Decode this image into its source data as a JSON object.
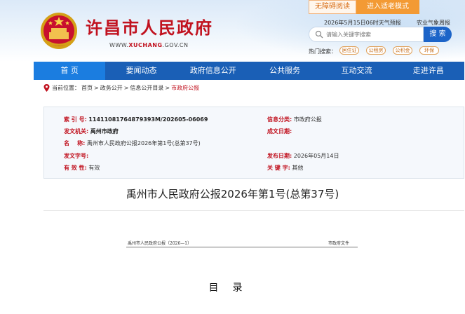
{
  "header": {
    "site_title": "许昌市人民政府",
    "domain_prefix": "WWW.",
    "domain_highlight": "XUCHANG",
    "domain_suffix": ".GOV.CN",
    "barrier_free": "无障碍阅读",
    "elder_mode": "进入适老模式",
    "weather": "2026年5月15日06时天气预报",
    "agri_weather": "农业气象周报",
    "search_placeholder": "请输入关键字搜索",
    "search_button": "搜 索",
    "hot_label": "热门搜索：",
    "hot_tags": [
      "居住证",
      "公租房",
      "公积金",
      "环保"
    ]
  },
  "nav": {
    "items": [
      "首 页",
      "要闻动态",
      "政府信息公开",
      "公共服务",
      "互动交流",
      "走进许昌"
    ]
  },
  "breadcrumb": {
    "label": "当前位置：",
    "items": [
      "首页",
      "政务公开",
      "信息公开目录"
    ],
    "current": "市政府公报",
    "sep": ">"
  },
  "info": {
    "index_label": "索 引 号:",
    "index_value": "11411081764879393M/202605-06069",
    "category_label": "信息分类:",
    "category_value": "市政府公报",
    "issuer_label": "发文机关:",
    "issuer_value": "禹州市政府",
    "date_label": "成文日期:",
    "date_value": "",
    "name_label": "名    称:",
    "name_value": "禹州市人民政府公报2026年第1号(总第37号)",
    "docno_label": "发文字号:",
    "docno_value": "",
    "pubdate_label": "发布日期:",
    "pubdate_value": "2026年05月14日",
    "validity_label": "有 效 性:",
    "validity_value": "有效",
    "keyword_label": "关 键 字:",
    "keyword_value": "其他"
  },
  "document": {
    "title": "禹州市人民政府公报2026年第1号(总第37号)",
    "header_left": "禹州市人民政府公报（2026—1）",
    "header_right": "市政府文件",
    "toc_title": "目录"
  },
  "colors": {
    "brand_red": "#c1121f",
    "nav_blue": "#1a5fb6",
    "nav_active": "#1b7de0",
    "elder_orange": "#f39a34"
  }
}
